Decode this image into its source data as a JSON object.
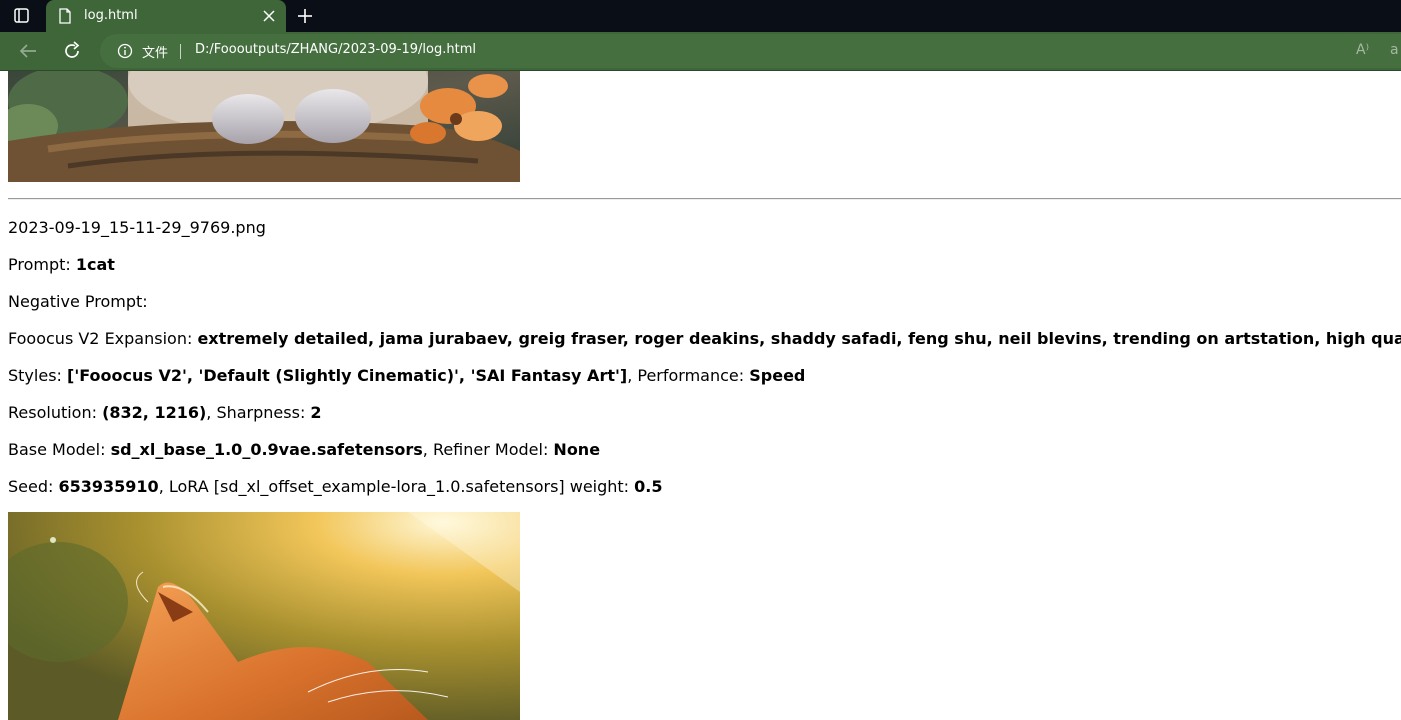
{
  "browser": {
    "tab_title": "log.html",
    "address_chip": "文件",
    "url": "D:/Foooutputs/ZHANG/2023-09-19/log.html",
    "read_aloud_label": "A⁾",
    "partial_button_label": "a"
  },
  "entry": {
    "filename": "2023-09-19_15-11-29_9769.png",
    "prompt_label": "Prompt: ",
    "prompt_value": "1cat",
    "negative_label": "Negative Prompt: ",
    "negative_value": "",
    "expansion_label": "Fooocus V2 Expansion: ",
    "expansion_value": "extremely detailed, jama jurabaev, greig fraser, roger deakins, shaddy safadi, feng shu, neil blevins, trending on artstation, high quality, brush stroke",
    "styles_label": "Styles: ",
    "styles_value": "['Fooocus V2', 'Default (Slightly Cinematic)', 'SAI Fantasy Art']",
    "performance_label": ", Performance: ",
    "performance_value": "Speed",
    "resolution_label": "Resolution: ",
    "resolution_value": "(832, 1216)",
    "sharpness_label": ", Sharpness: ",
    "sharpness_value": "2",
    "base_model_label": "Base Model: ",
    "base_model_value": "sd_xl_base_1.0_0.9vae.safetensors",
    "refiner_label": ", Refiner Model: ",
    "refiner_value": "None",
    "seed_label": "Seed: ",
    "seed_value": "653935910",
    "lora_label": ", LoRA [sd_xl_offset_example-lora_1.0.safetensors] weight: ",
    "lora_value": "0.5"
  },
  "colors": {
    "tabbar_bg": "#0a0f17",
    "toolbar_bg": "#3e6638",
    "address_bg": "#466f40"
  },
  "icons": [
    "tab-actions-icon",
    "page-icon",
    "close-icon",
    "plus-icon",
    "back-arrow-icon",
    "reload-icon",
    "info-icon",
    "read-aloud-icon"
  ]
}
